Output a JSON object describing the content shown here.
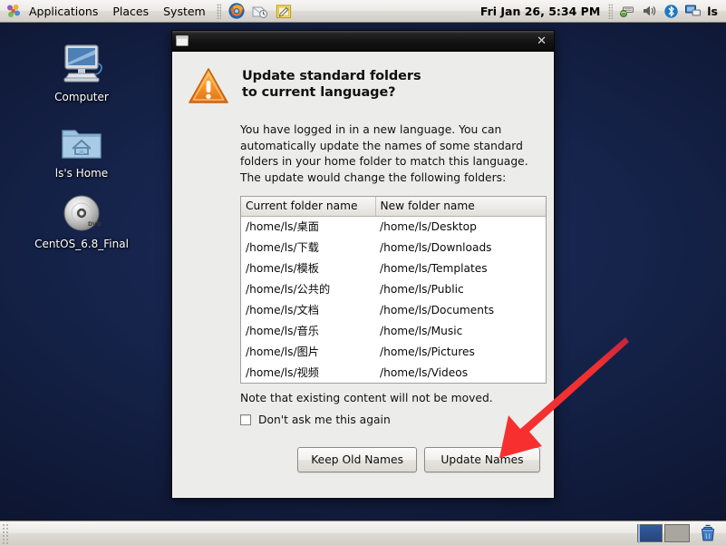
{
  "top_panel": {
    "logo_icon": "centos-foot-icon",
    "menus": [
      {
        "label": "Applications",
        "name": "menu-applications"
      },
      {
        "label": "Places",
        "name": "menu-places"
      },
      {
        "label": "System",
        "name": "menu-system"
      }
    ],
    "launchers": [
      {
        "name": "firefox-launcher-icon",
        "title": "Firefox Web Browser"
      },
      {
        "name": "evolution-mail-launcher-icon",
        "title": "Evolution Mail"
      },
      {
        "name": "text-editor-launcher-icon",
        "title": "Text Editor"
      }
    ],
    "clock": "Fri Jan 26,  5:34 PM",
    "tray": [
      {
        "name": "network-icon"
      },
      {
        "name": "volume-icon"
      },
      {
        "name": "bluetooth-icon"
      },
      {
        "name": "display-icon"
      }
    ],
    "user": "ls"
  },
  "desktop": {
    "icons": [
      {
        "name": "computer",
        "label": "Computer",
        "icon": "computer-icon"
      },
      {
        "name": "home",
        "label": "ls's Home",
        "icon": "home-folder-icon"
      },
      {
        "name": "dvd",
        "label": "CentOS_6.8_Final",
        "icon": "dvd-disc-icon"
      }
    ]
  },
  "dialog": {
    "title": "",
    "window_icon": "window-menu-icon",
    "close_label": "✕",
    "warning_icon": "warning-triangle-icon",
    "heading_line1": "Update standard folders",
    "heading_line2": "to current language?",
    "body_text": "You have logged in in a new language. You can automatically update the names of some standard folders in your home folder to match this language. The update would change the following folders:",
    "table": {
      "columns": [
        "Current folder name",
        "New folder name"
      ],
      "rows": [
        [
          "/home/ls/桌面",
          "/home/ls/Desktop"
        ],
        [
          "/home/ls/下载",
          "/home/ls/Downloads"
        ],
        [
          "/home/ls/模板",
          "/home/ls/Templates"
        ],
        [
          "/home/ls/公共的",
          "/home/ls/Public"
        ],
        [
          "/home/ls/文档",
          "/home/ls/Documents"
        ],
        [
          "/home/ls/音乐",
          "/home/ls/Music"
        ],
        [
          "/home/ls/图片",
          "/home/ls/Pictures"
        ],
        [
          "/home/ls/视频",
          "/home/ls/Videos"
        ]
      ]
    },
    "note": "Note that existing content will not be moved.",
    "checkbox_label": "Don't ask me this again",
    "checkbox_checked": false,
    "buttons": {
      "keep": "Keep Old Names",
      "update": "Update Names"
    }
  },
  "annotation": {
    "arrow_color": "#f02b2b",
    "arrow_name": "red-pointer-arrow",
    "points_to": "Update Names"
  },
  "bottom_panel": {
    "grip": "panel-grip",
    "workspaces": [
      {
        "name": "workspace-1",
        "active": true
      },
      {
        "name": "workspace-2",
        "active": false
      }
    ],
    "trash": "trash-icon"
  }
}
